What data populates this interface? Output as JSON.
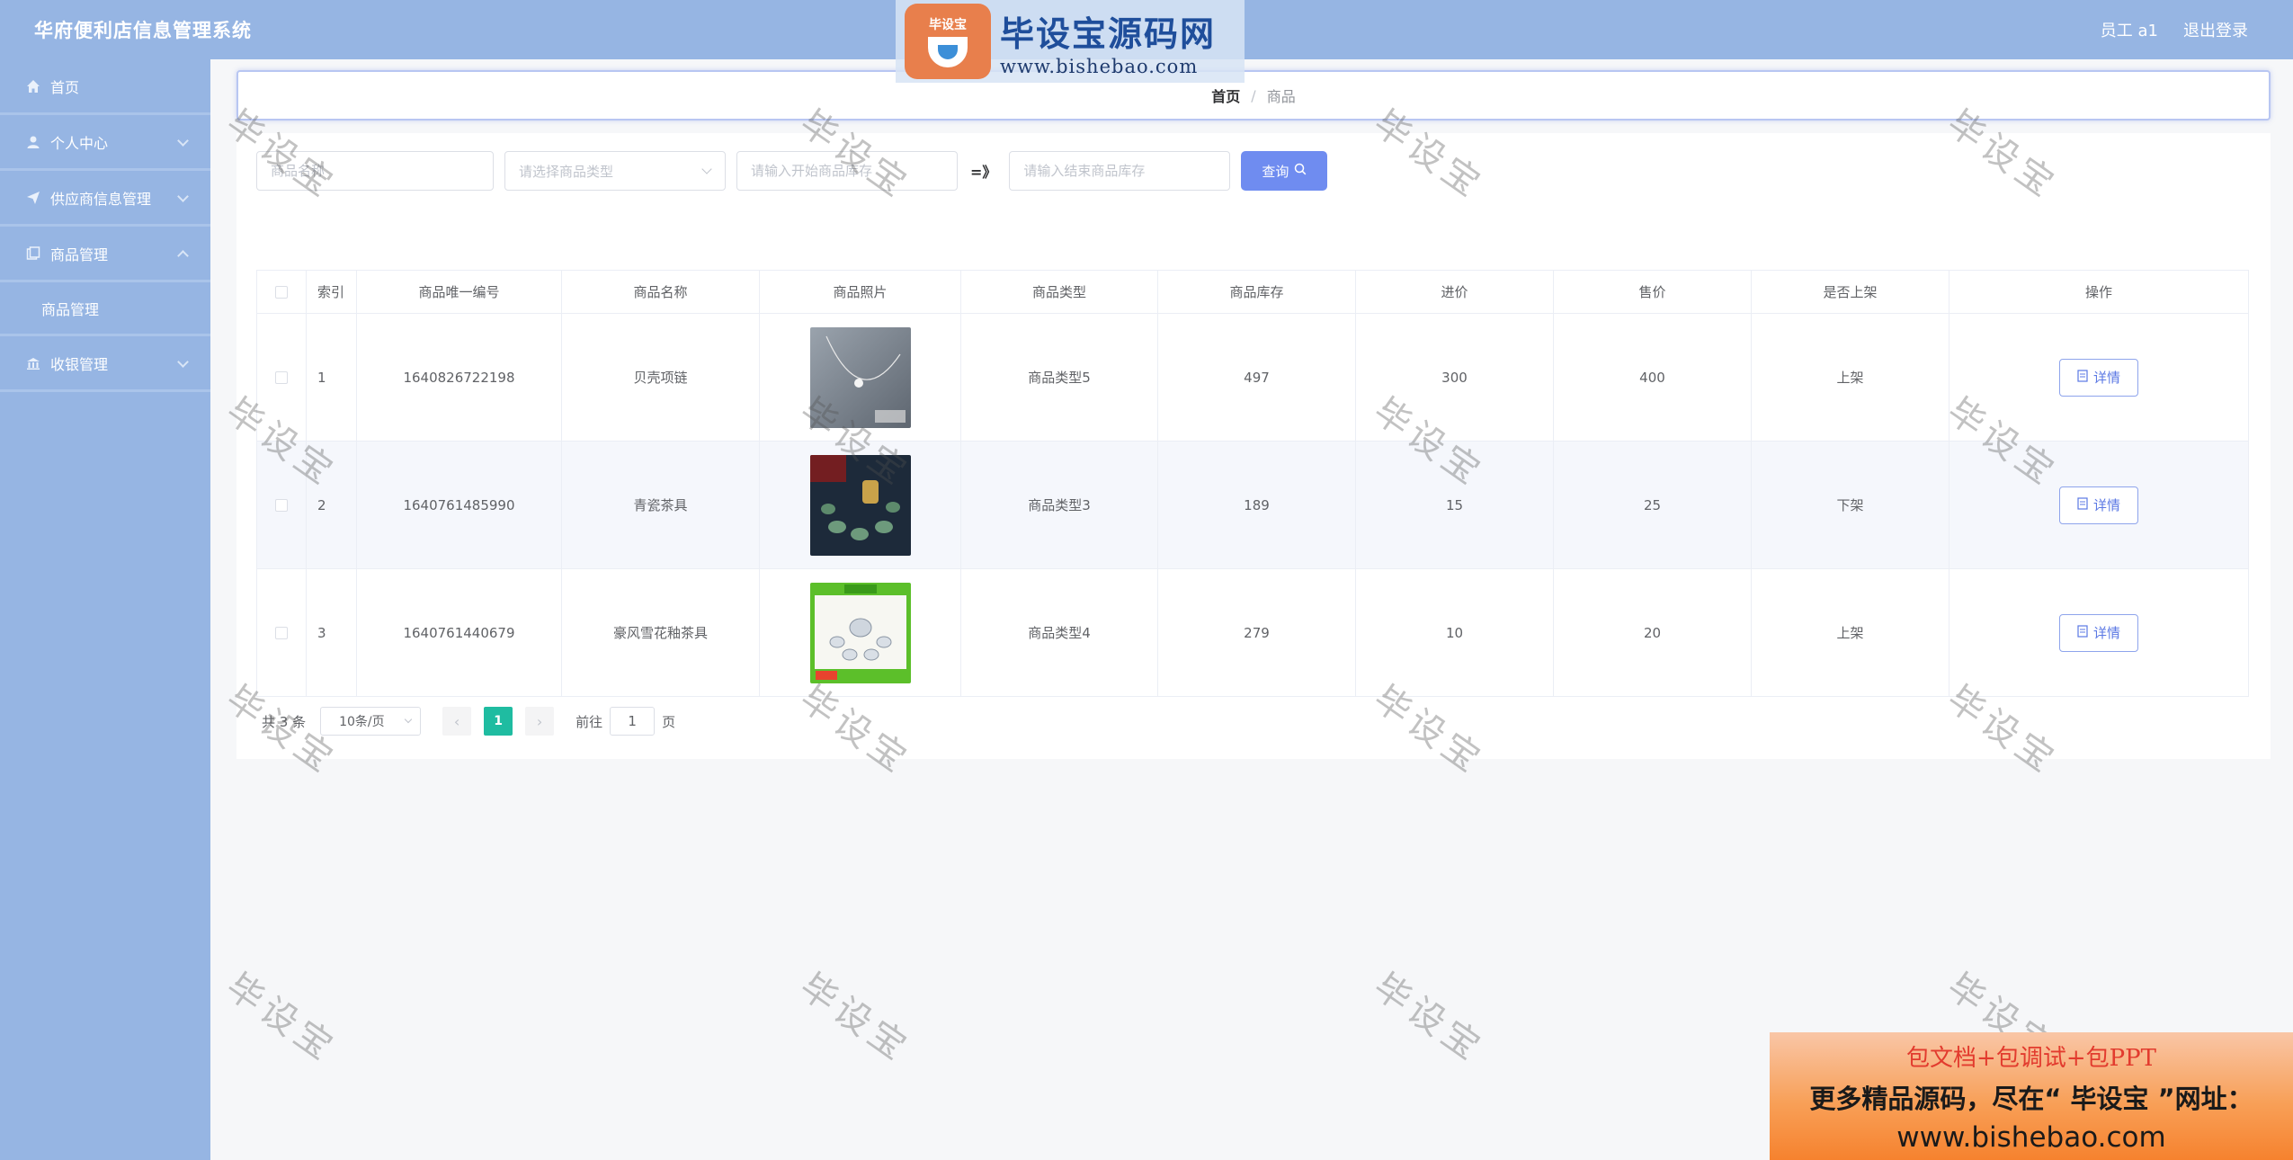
{
  "header": {
    "title": "华府便利店信息管理系统",
    "user": "员工 a1",
    "logout": "退出登录"
  },
  "sidebar": {
    "items": [
      {
        "label": "首页",
        "icon": "home-icon"
      },
      {
        "label": "个人中心",
        "icon": "user-icon"
      },
      {
        "label": "供应商信息管理",
        "icon": "send-icon"
      },
      {
        "label": "商品管理",
        "icon": "document-icon"
      },
      {
        "label": "收银管理",
        "icon": "bank-icon"
      }
    ],
    "submenu": [
      "商品管理"
    ]
  },
  "breadcrumb": {
    "home": "首页",
    "separator": "/",
    "current": "商品"
  },
  "search": {
    "name_placeholder": "商品名称",
    "type_placeholder": "请选择商品类型",
    "stock_start_placeholder": "请输入开始商品库存",
    "range_sep": "=》",
    "stock_end_placeholder": "请输入结束商品库存",
    "button": "查询"
  },
  "table": {
    "headers": [
      "索引",
      "商品唯一编号",
      "商品名称",
      "商品照片",
      "商品类型",
      "商品库存",
      "进价",
      "售价",
      "是否上架",
      "操作"
    ],
    "rows": [
      {
        "index": "1",
        "code": "1640826722198",
        "name": "贝壳项链",
        "type": "商品类型5",
        "stock": "497",
        "cost": "300",
        "price": "400",
        "status": "上架",
        "action": "详情"
      },
      {
        "index": "2",
        "code": "1640761485990",
        "name": "青瓷茶具",
        "type": "商品类型3",
        "stock": "189",
        "cost": "15",
        "price": "25",
        "status": "下架",
        "action": "详情"
      },
      {
        "index": "3",
        "code": "1640761440679",
        "name": "豪风雪花釉茶具",
        "type": "商品类型4",
        "stock": "279",
        "cost": "10",
        "price": "20",
        "status": "上架",
        "action": "详情"
      }
    ]
  },
  "pagination": {
    "total": "共 3 条",
    "page_size": "10条/页",
    "prev": "‹",
    "current": "1",
    "next": "›",
    "goto_label": "前往",
    "goto_value": "1",
    "page_unit": "页"
  },
  "overlay": {
    "logo_badge": "毕设宝",
    "logo_cn": "毕设宝源码网",
    "logo_url": "www.bishebao.com",
    "watermark": "毕设宝",
    "promo_line1": "包文档+包调试+包PPT",
    "promo_line2": "更多精品源码，尽在“ 毕设宝 ”网址：",
    "promo_line3": "www.bishebao.com"
  },
  "colors": {
    "header_bg": "#96b5e3",
    "accent": "#6f8cf0",
    "page_active": "#1fbca1"
  }
}
